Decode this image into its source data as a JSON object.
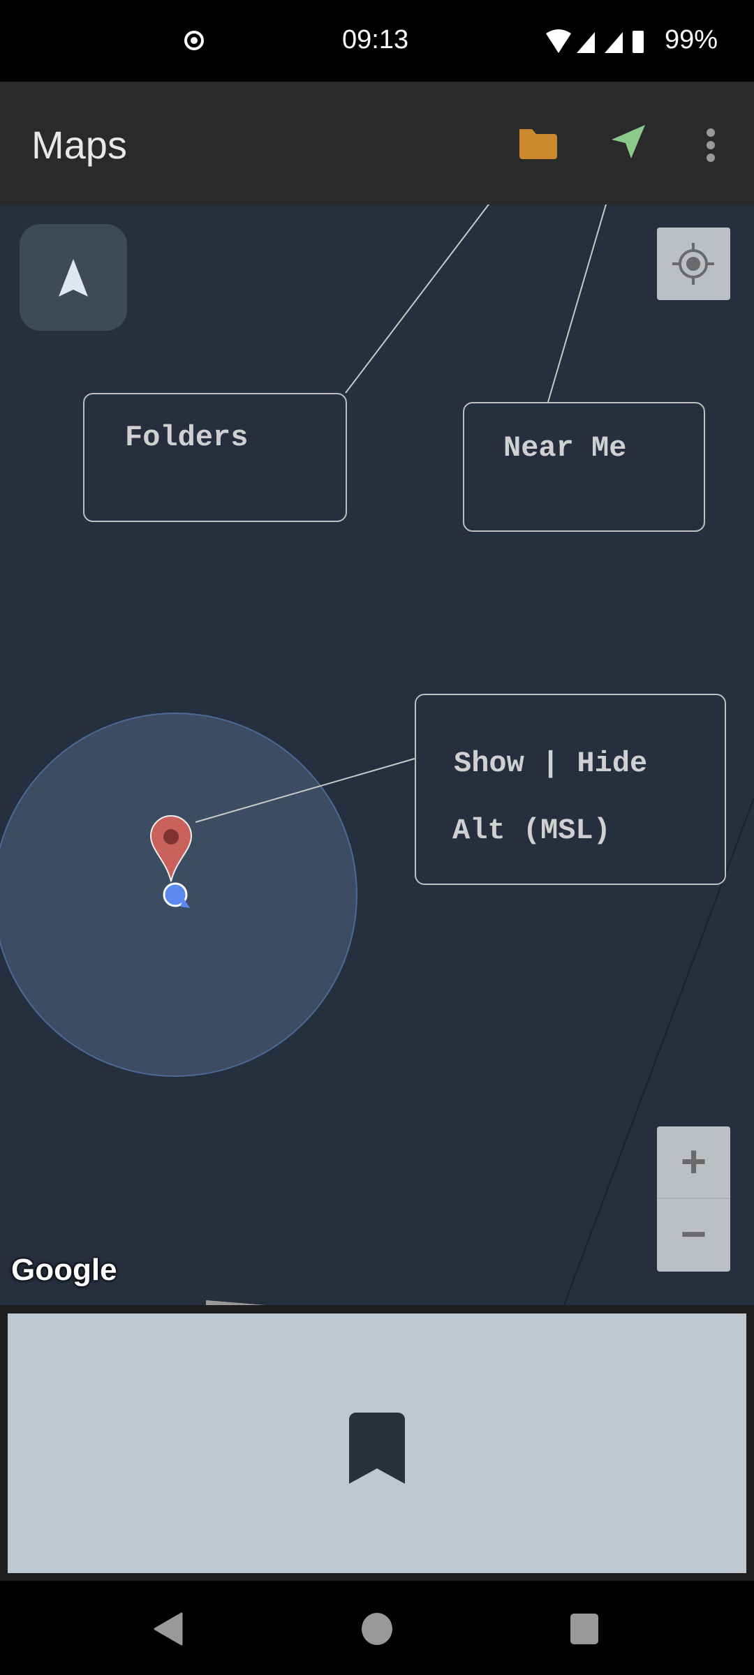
{
  "status_bar": {
    "time": "09:13",
    "battery": "99%",
    "icons": [
      "location-target-icon",
      "wifi-icon",
      "signal-icon",
      "signal-icon",
      "battery-icon"
    ]
  },
  "app_bar": {
    "title": "Maps",
    "actions": [
      "folder-icon",
      "navigation-arrow-icon",
      "more-vert-icon"
    ],
    "colors": {
      "folder": "#cc8a2e",
      "nav": "#8bc98b"
    }
  },
  "map": {
    "callouts": {
      "folders": "Folders",
      "near_me": "Near Me",
      "show_hide": "Show | Hide",
      "alt": "Alt (MSL)"
    },
    "attribution": "Google",
    "zoom_in": "+",
    "zoom_out": "−"
  },
  "bottom_panel": {
    "icon": "bookmark-icon"
  },
  "nav_bar": {
    "buttons": [
      "back",
      "home",
      "recents"
    ]
  }
}
